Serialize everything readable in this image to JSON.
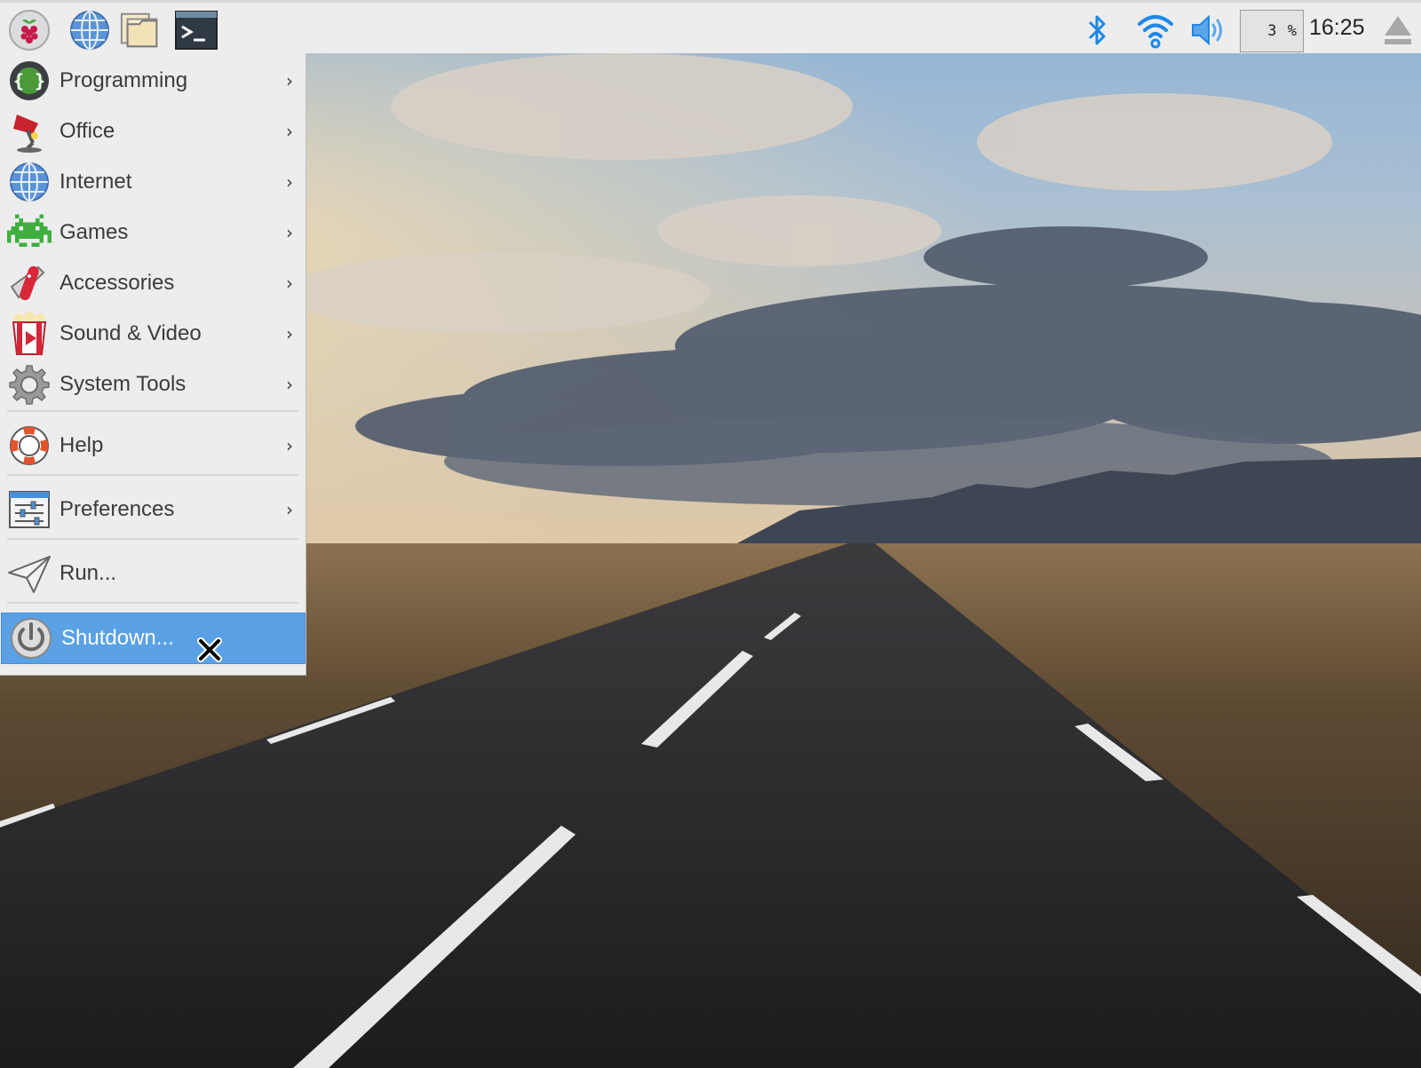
{
  "panel": {
    "launchers": [
      {
        "icon": "raspberry-menu-icon"
      },
      {
        "icon": "web-browser-icon"
      },
      {
        "icon": "file-manager-icon"
      },
      {
        "icon": "terminal-icon"
      }
    ],
    "tray": {
      "bluetooth_icon": "bluetooth-icon",
      "wifi_icon": "wifi-icon",
      "volume_icon": "volume-icon",
      "cpu_usage": "3 %",
      "clock": "16:25",
      "eject_icon": "eject-icon"
    }
  },
  "menu": {
    "items": [
      {
        "label": "Programming",
        "icon": "programming-icon",
        "submenu": true
      },
      {
        "label": "Office",
        "icon": "office-icon",
        "submenu": true
      },
      {
        "label": "Internet",
        "icon": "internet-icon",
        "submenu": true
      },
      {
        "label": "Games",
        "icon": "games-icon",
        "submenu": true
      },
      {
        "label": "Accessories",
        "icon": "accessories-icon",
        "submenu": true
      },
      {
        "label": "Sound & Video",
        "icon": "sound-video-icon",
        "submenu": true
      },
      {
        "label": "System Tools",
        "icon": "system-tools-icon",
        "submenu": true
      },
      {
        "label": "Help",
        "icon": "help-icon",
        "submenu": true
      },
      {
        "label": "Preferences",
        "icon": "preferences-icon",
        "submenu": true
      },
      {
        "label": "Run...",
        "icon": "run-icon",
        "submenu": false
      },
      {
        "label": "Shutdown...",
        "icon": "shutdown-icon",
        "submenu": false,
        "highlighted": true
      }
    ],
    "submenu_arrow": "›"
  },
  "colors": {
    "panel_bg": "#ededed",
    "menu_bg": "#ededed",
    "highlight": "#5aa1e6",
    "tray_icon_blue": "#1e88e5"
  }
}
